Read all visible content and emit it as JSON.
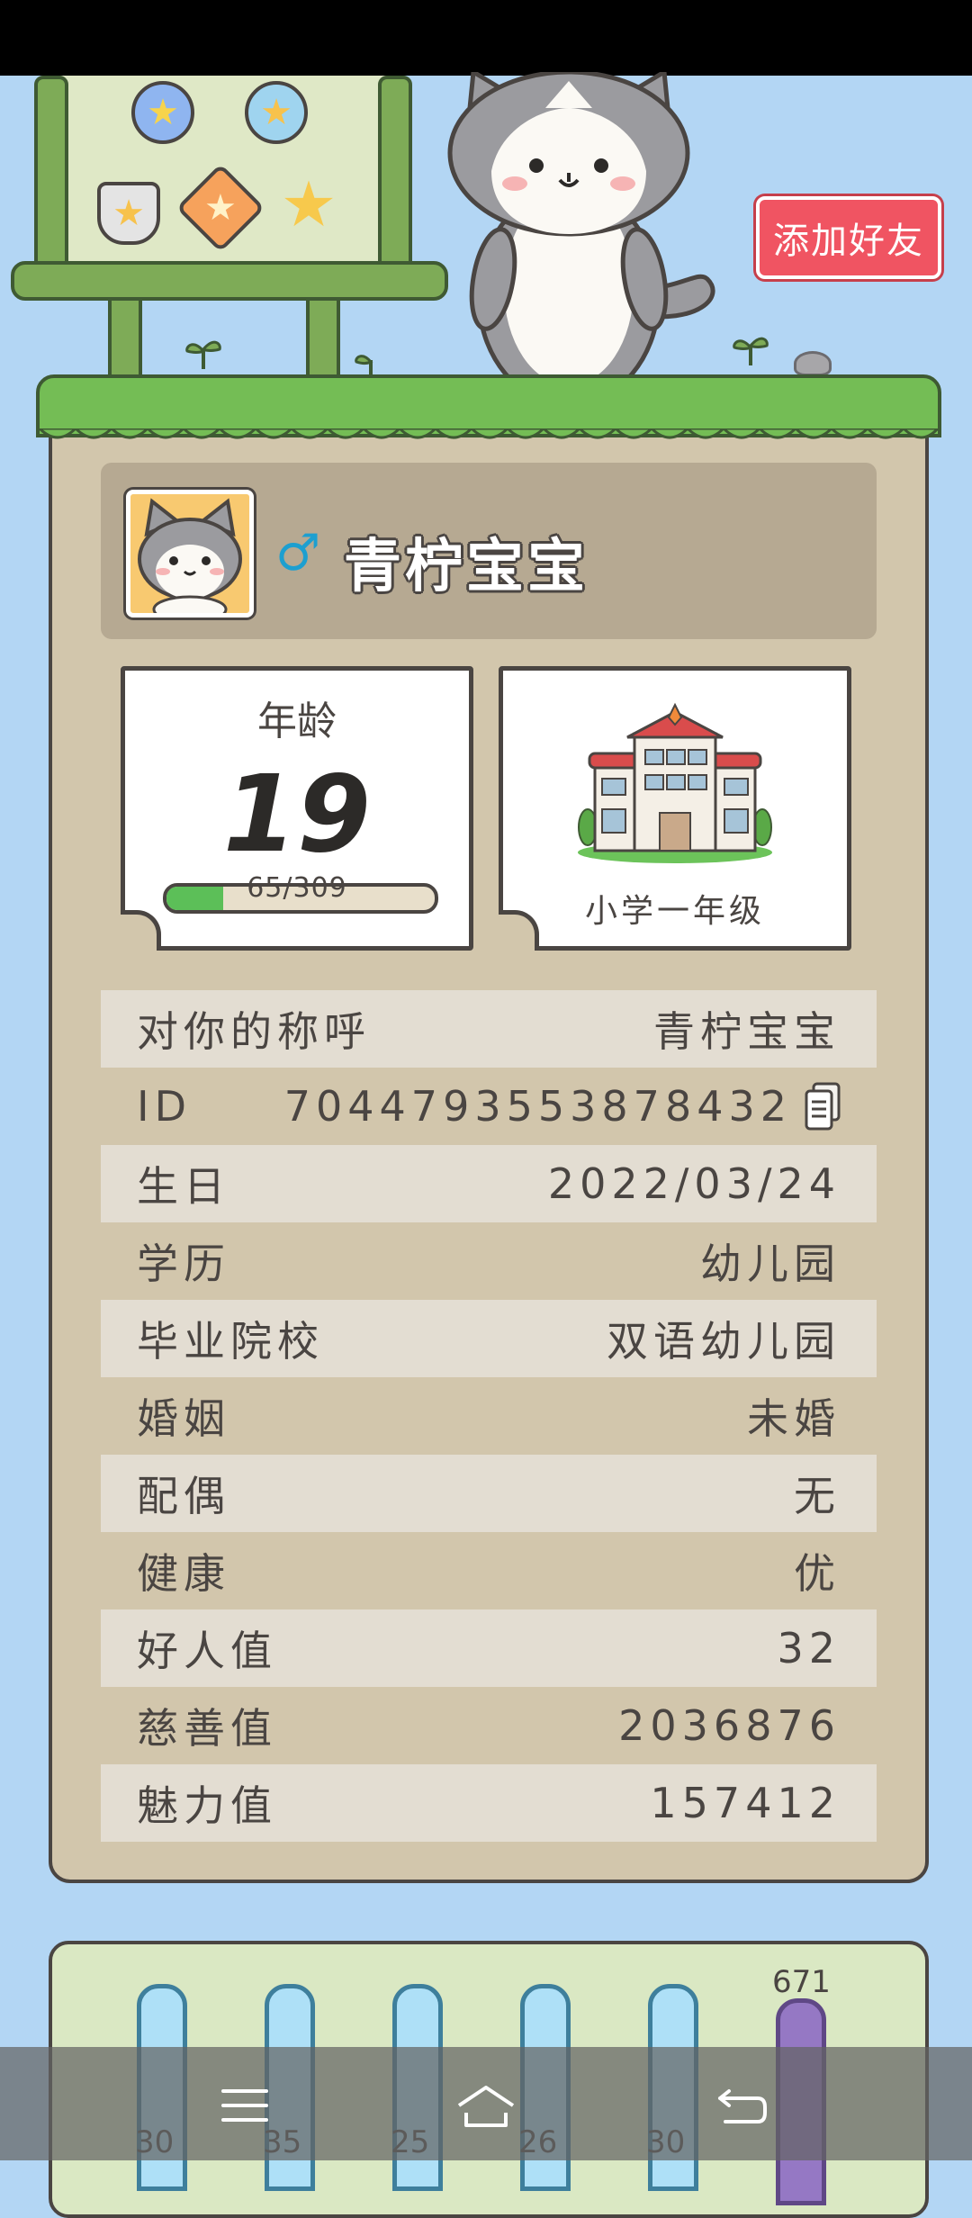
{
  "header": {
    "add_friend_label": "添加好友"
  },
  "profile": {
    "nickname": "青柠宝宝",
    "gender_symbol": "♂"
  },
  "age_card": {
    "title": "年龄",
    "age": "19",
    "progress_text": "65/309",
    "progress_fraction": 0.21
  },
  "school_card": {
    "label": "小学一年级"
  },
  "info_rows": [
    {
      "label": "对你的称呼",
      "value": "青柠宝宝"
    },
    {
      "label": "ID",
      "value": "7044793553878432"
    },
    {
      "label": "生日",
      "value": "2022/03/24"
    },
    {
      "label": "学历",
      "value": "幼儿园"
    },
    {
      "label": "毕业院校",
      "value": "双语幼儿园"
    },
    {
      "label": "婚姻",
      "value": "未婚"
    },
    {
      "label": "配偶",
      "value": "无"
    },
    {
      "label": "健康",
      "value": "优"
    },
    {
      "label": "好人值",
      "value": "32"
    },
    {
      "label": "慈善值",
      "value": "2036876"
    },
    {
      "label": "魅力值",
      "value": "157412"
    }
  ],
  "stat_tubes": [
    {
      "value": "30",
      "color": "#aee0f7"
    },
    {
      "value": "35",
      "color": "#aee0f7"
    },
    {
      "value": "25",
      "color": "#aee0f7"
    },
    {
      "value": "26",
      "color": "#aee0f7"
    },
    {
      "value": "30",
      "color": "#aee0f7"
    },
    {
      "value": "671",
      "color": "#9578c4"
    }
  ],
  "icons": [
    "copy-icon",
    "menu-icon",
    "home-icon",
    "back-icon",
    "school-building-icon",
    "cat-mascot-icon"
  ],
  "colors": {
    "background": "#b3d6f4",
    "panel": "#d2c6ac",
    "accent_red": "#f05462",
    "grass": "#74bd55",
    "male_blue": "#1d9fd0"
  }
}
